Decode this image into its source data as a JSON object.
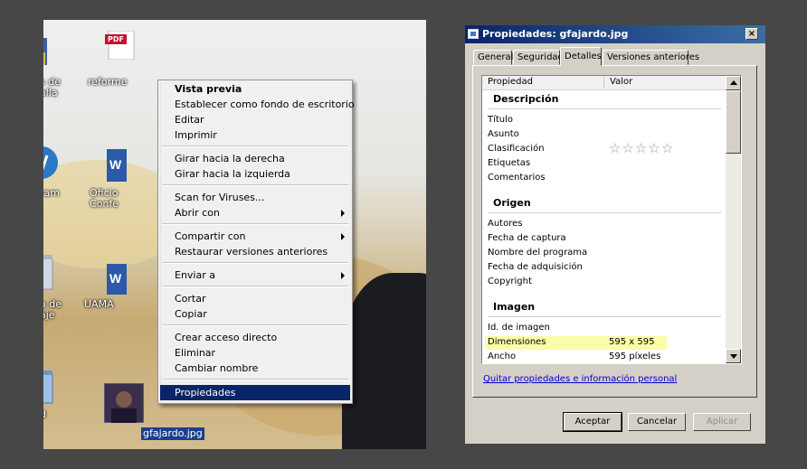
{
  "desktop": {
    "icons": [
      {
        "label": "s de\nalla"
      },
      {
        "label": "reforme"
      },
      {
        "label": "ram"
      },
      {
        "label": "Oficio\nConfe"
      },
      {
        "label": "a de\naje"
      },
      {
        "label": "UAMA"
      },
      {
        "label": "d"
      }
    ],
    "pdf_badge": "PDF",
    "selected_file": "gfajardo.jpg"
  },
  "context_menu": {
    "items": [
      {
        "label": "Vista previa",
        "bold": true
      },
      {
        "label": "Establecer como fondo de escritorio"
      },
      {
        "label": "Editar"
      },
      {
        "label": "Imprimir"
      },
      {
        "label": "Girar hacia la derecha"
      },
      {
        "label": "Girar hacia la izquierda"
      },
      {
        "label": "Scan for Viruses..."
      },
      {
        "label": "Abrir con",
        "submenu": true
      },
      {
        "label": "Compartir con",
        "submenu": true
      },
      {
        "label": "Restaurar versiones anteriores"
      },
      {
        "label": "Enviar a",
        "submenu": true
      },
      {
        "label": "Cortar"
      },
      {
        "label": "Copiar"
      },
      {
        "label": "Crear acceso directo"
      },
      {
        "label": "Eliminar"
      },
      {
        "label": "Cambiar nombre"
      },
      {
        "label": "Propiedades",
        "selected": true
      }
    ]
  },
  "dialog": {
    "title": "Propiedades: gfajardo.jpg",
    "close": "×",
    "tabs": [
      "General",
      "Seguridad",
      "Detalles",
      "Versiones anteriores"
    ],
    "active_tab": "Detalles",
    "columns": {
      "property": "Propiedad",
      "value": "Valor"
    },
    "sections": [
      {
        "name": "Descripción",
        "rows": [
          "Título",
          "Asunto",
          "Clasificación",
          "Etiquetas",
          "Comentarios"
        ]
      },
      {
        "name": "Origen",
        "rows": [
          "Autores",
          "Fecha de captura",
          "Nombre del programa",
          "Fecha de adquisición",
          "Copyright"
        ]
      },
      {
        "name": "Imagen",
        "rows": [
          "Id. de imagen",
          "Dimensiones",
          "Ancho"
        ]
      }
    ],
    "rating_stars": 5,
    "values": {
      "dimensiones": "595 x 595",
      "ancho": "595 píxeles"
    },
    "highlight_row": "Dimensiones",
    "link": "Quitar propiedades e información personal",
    "buttons": {
      "ok": "Aceptar",
      "cancel": "Cancelar",
      "apply": "Aplicar"
    },
    "colors": {
      "titlebar": "#0a246a",
      "highlight": "#fbfca8",
      "link": "#0000cc"
    }
  }
}
